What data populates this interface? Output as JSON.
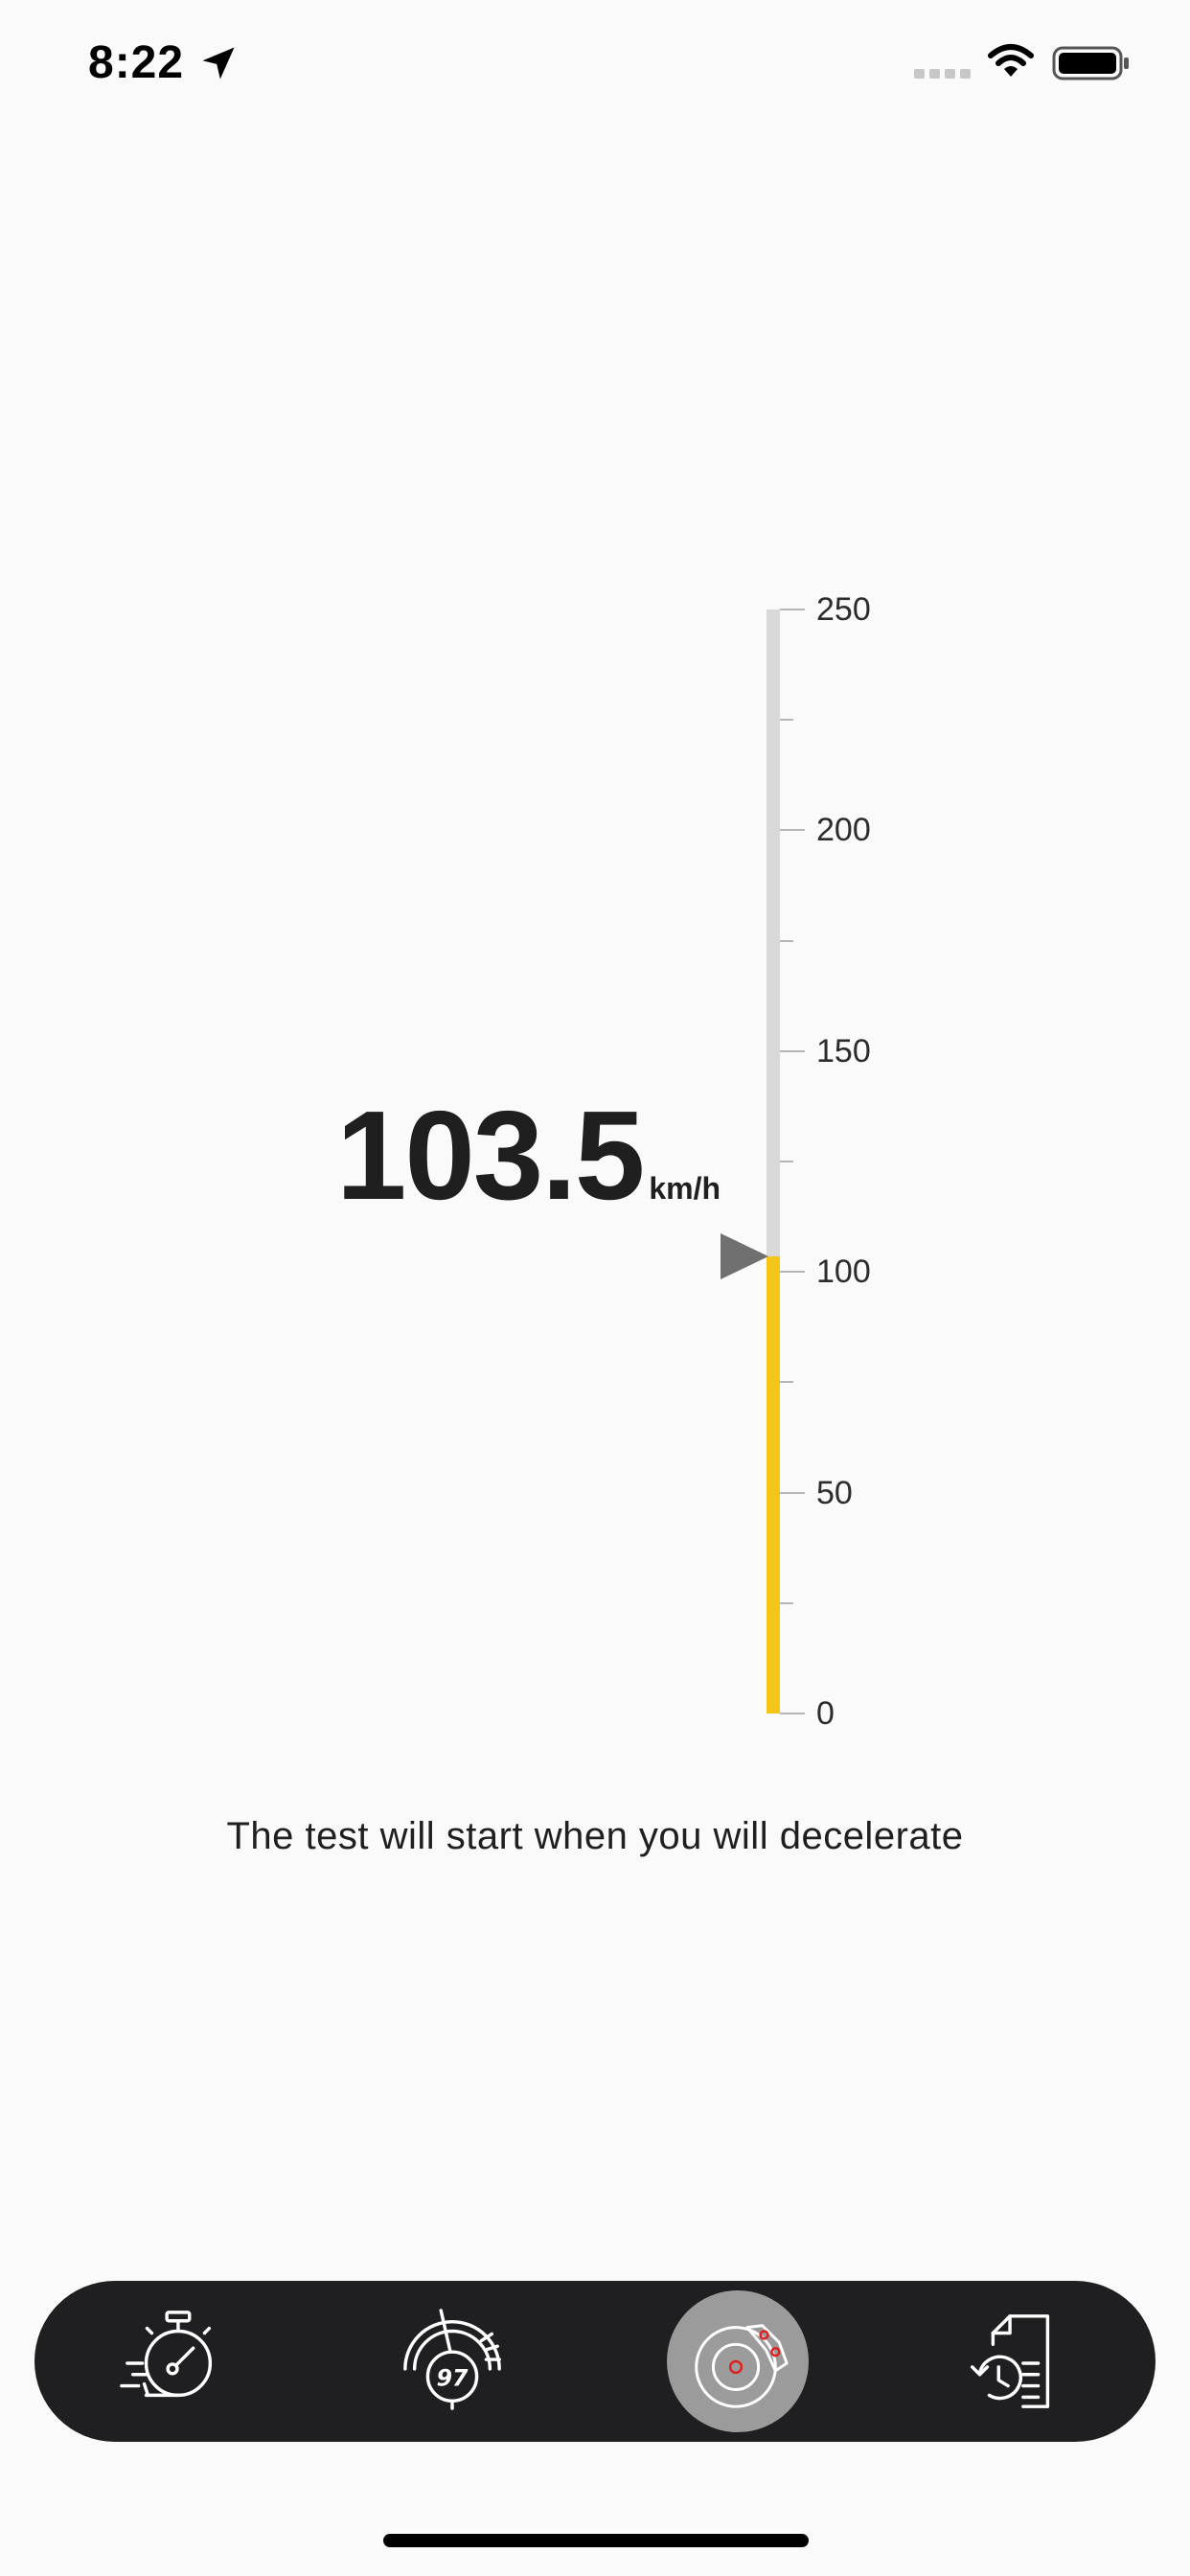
{
  "status_bar": {
    "time": "8:22",
    "location_icon": "location-arrow-icon",
    "signal_icon": "cellular-signal-icon",
    "wifi_icon": "wifi-icon",
    "battery_icon": "battery-icon"
  },
  "speed": {
    "value": "103.5",
    "unit": "km/h"
  },
  "gauge": {
    "min": 0,
    "max": 250,
    "current": 103.5,
    "major_ticks": [
      "250",
      "200",
      "150",
      "100",
      "50",
      "0"
    ],
    "track_color": "#d9d9d9",
    "fill_color": "#f5c518",
    "pointer_color": "#707070"
  },
  "instruction": "The test will start when you will decelerate",
  "tab_bar": {
    "items": [
      {
        "icon": "stopwatch-icon",
        "active": false
      },
      {
        "icon": "speedometer-icon",
        "active": false,
        "badge": "97"
      },
      {
        "icon": "brake-disc-icon",
        "active": true
      },
      {
        "icon": "history-document-icon",
        "active": false
      }
    ],
    "background": "#1f1f22",
    "active_background": "#9b9b9b"
  }
}
